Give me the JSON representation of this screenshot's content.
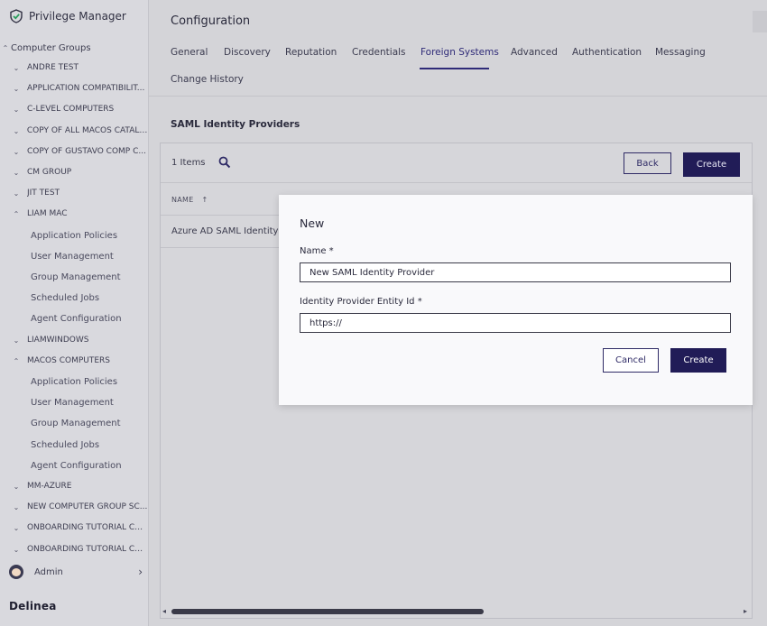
{
  "app": {
    "title": "Privilege Manager",
    "footer_brand": "Delinea"
  },
  "sidebar": {
    "root": "Computer Groups",
    "items": [
      {
        "label": "ANDRE TEST",
        "type": "group",
        "expanded": false
      },
      {
        "label": "APPLICATION COMPATIBILIT...",
        "type": "group",
        "expanded": false
      },
      {
        "label": "C-LEVEL COMPUTERS",
        "type": "group",
        "expanded": false
      },
      {
        "label": "COPY OF ALL MACOS CATALI...",
        "type": "group",
        "expanded": false
      },
      {
        "label": "COPY OF GUSTAVO COMP C...",
        "type": "group",
        "expanded": false
      },
      {
        "label": "CM GROUP",
        "type": "group",
        "expanded": false
      },
      {
        "label": "JIT TEST",
        "type": "group",
        "expanded": false
      },
      {
        "label": "LIAM MAC",
        "type": "group",
        "expanded": true
      },
      {
        "label": "Application Policies",
        "type": "child"
      },
      {
        "label": "User Management",
        "type": "child"
      },
      {
        "label": "Group Management",
        "type": "child"
      },
      {
        "label": "Scheduled Jobs",
        "type": "child"
      },
      {
        "label": "Agent Configuration",
        "type": "child"
      },
      {
        "label": "LIAMWINDOWS",
        "type": "group",
        "expanded": false
      },
      {
        "label": "MACOS COMPUTERS",
        "type": "group",
        "expanded": true
      },
      {
        "label": "Application Policies",
        "type": "child"
      },
      {
        "label": "User Management",
        "type": "child"
      },
      {
        "label": "Group Management",
        "type": "child"
      },
      {
        "label": "Scheduled Jobs",
        "type": "child"
      },
      {
        "label": "Agent Configuration",
        "type": "child"
      },
      {
        "label": "MM-AZURE",
        "type": "group",
        "expanded": false
      },
      {
        "label": "NEW COMPUTER GROUP SC...",
        "type": "group",
        "expanded": false
      },
      {
        "label": "ONBOARDING TUTORIAL CO...",
        "type": "group",
        "expanded": false
      },
      {
        "label": "ONBOARDING TUTORIAL CO...",
        "type": "group",
        "expanded": false
      }
    ],
    "admin_label": "Admin"
  },
  "header": {
    "title": "Configuration"
  },
  "tabs": [
    {
      "label": "General",
      "active": false
    },
    {
      "label": "Discovery",
      "active": false
    },
    {
      "label": "Reputation",
      "active": false
    },
    {
      "label": "Credentials",
      "active": false
    },
    {
      "label": "Foreign Systems",
      "active": true
    },
    {
      "label": "Advanced",
      "active": false
    },
    {
      "label": "Authentication",
      "active": false
    },
    {
      "label": "Messaging",
      "active": false
    },
    {
      "label": "Change History",
      "active": false
    }
  ],
  "section": {
    "title": "SAML Identity Providers"
  },
  "table": {
    "count_label": "1 Items",
    "back_label": "Back",
    "create_label": "Create",
    "column_name": "NAME",
    "sort_indicator": "↑",
    "rows": [
      {
        "name": "Azure AD SAML Identity Pro"
      }
    ]
  },
  "modal": {
    "title": "New",
    "name_label": "Name *",
    "name_value": "New SAML Identity Provider",
    "entity_label": "Identity Provider Entity Id *",
    "entity_value": "https://",
    "cancel_label": "Cancel",
    "create_label": "Create"
  },
  "colors": {
    "accent": "#211c57",
    "active_tab": "#2f2b78",
    "brand_check": "#2a9d5c"
  }
}
